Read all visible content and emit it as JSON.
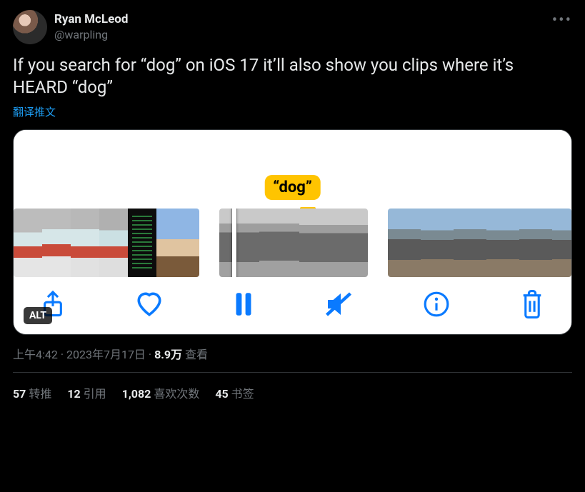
{
  "author": {
    "display_name": "Ryan McLeod",
    "handle": "@warpling"
  },
  "content_text": "If you search for “dog” on iOS 17 it’ll also show you clips where it’s HEARD “dog”",
  "translate_label": "翻译推文",
  "media": {
    "search_tag": "“dog”",
    "alt_badge": "ALT"
  },
  "meta": {
    "time": "上午4:42",
    "dot1": " · ",
    "date": "2023年7月17日",
    "dot2": " · ",
    "views_count": "8.9万",
    "views_label": " 查看"
  },
  "stats": {
    "retweets_count": "57",
    "retweets_label": " 转推",
    "quotes_count": "12",
    "quotes_label": " 引用",
    "likes_count": "1,082",
    "likes_label": " 喜欢次数",
    "bookmarks_count": "45",
    "bookmarks_label": " 书签"
  }
}
